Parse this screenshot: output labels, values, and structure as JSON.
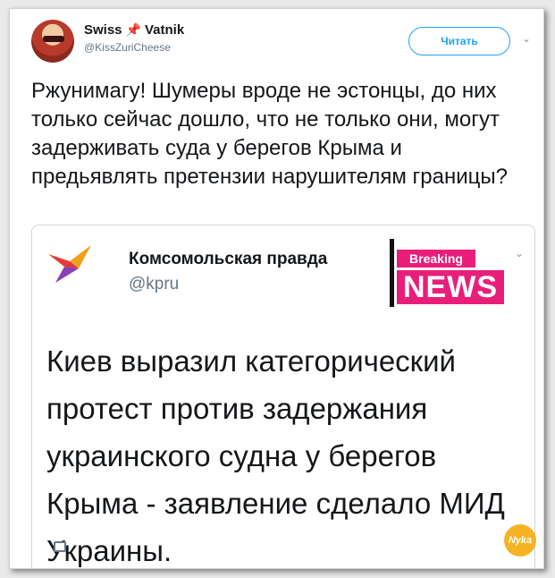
{
  "tweet": {
    "author_name": "Swiss",
    "author_name_suffix": "Vatnik",
    "pin_icon": "pushpin-icon",
    "author_handle": "@KissZuriCheese",
    "follow_label": "Читать",
    "text": "Ржунимагу! Шумеры вроде не эстонцы, до них только сейчас дошло, что не только они, могут задерживать суда у берегов Крыма и предьявлять претензии нарушителям границы?"
  },
  "quote": {
    "author_name": "Комсомольская правда",
    "author_handle": "@kpru",
    "breaking_label": "Breaking",
    "news_label": "NEWS",
    "text": "Киев выразил категорический протест против задержания украинского судна у берегов Крыма - заявление сделало МИД Украины."
  },
  "watermark": {
    "label": "Nyka"
  },
  "colors": {
    "accent": "#1da1f2",
    "breaking": "#e91e7b",
    "text": "#14171a",
    "secondary_text": "#657786"
  }
}
